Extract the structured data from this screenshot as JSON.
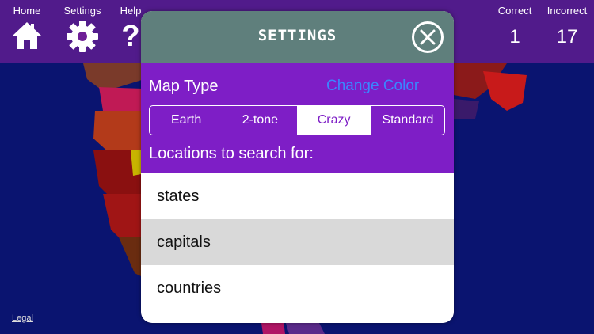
{
  "nav": {
    "home_label": "Home",
    "settings_label": "Settings",
    "help_label": "Help",
    "help_glyph": "?"
  },
  "score": {
    "correct_label": "Correct",
    "correct_value": "1",
    "incorrect_label": "Incorrect",
    "incorrect_value": "17"
  },
  "map": {
    "legal_label": "Legal"
  },
  "settings": {
    "title": "SETTINGS",
    "map_type_label": "Map Type",
    "change_color_label": "Change Color",
    "map_types": [
      "Earth",
      "2-tone",
      "Crazy",
      "Standard"
    ],
    "selected_map_type": "Crazy",
    "locations_label": "Locations to search for:",
    "locations": [
      "states",
      "capitals",
      "countries"
    ],
    "selected_location": "capitals"
  },
  "colors": {
    "ocean": "#0a1470",
    "topbar": "#6e1e96",
    "header": "#5f7f7c",
    "panel": "#7e1ec6",
    "link": "#3a86ff",
    "selected_row": "#d9d9d9"
  },
  "icons": {
    "home": "house-icon",
    "settings": "gear-icon",
    "help": "question-mark-icon",
    "close": "close-icon"
  }
}
